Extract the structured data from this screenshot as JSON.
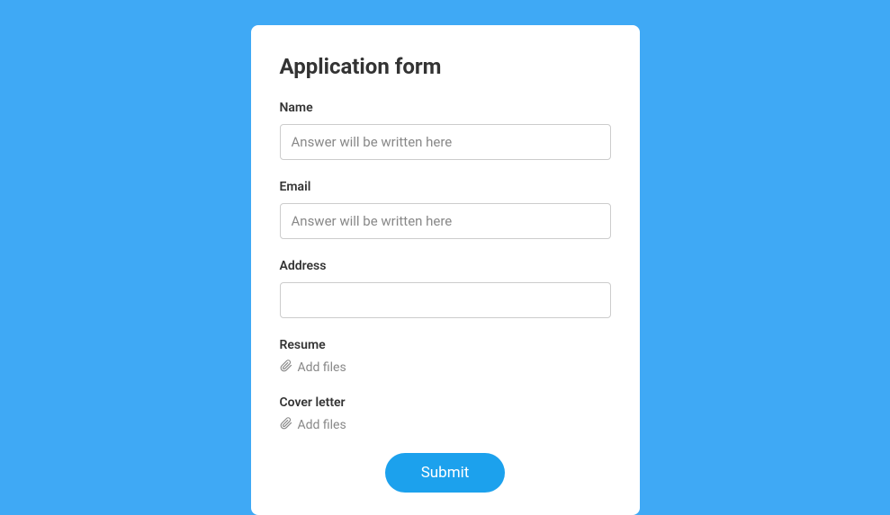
{
  "form": {
    "title": "Application form",
    "fields": {
      "name": {
        "label": "Name",
        "placeholder": "Answer will be written here",
        "value": ""
      },
      "email": {
        "label": "Email",
        "placeholder": "Answer will be written here",
        "value": ""
      },
      "address": {
        "label": "Address",
        "placeholder": "",
        "value": ""
      },
      "resume": {
        "label": "Resume",
        "add_files_label": "Add files"
      },
      "cover_letter": {
        "label": "Cover letter",
        "add_files_label": "Add files"
      }
    },
    "submit_label": "Submit"
  },
  "colors": {
    "background": "#3fa9f5",
    "card": "#ffffff",
    "primary": "#1ca1ed",
    "text": "#333333",
    "muted": "#888888",
    "border": "#cccccc"
  }
}
